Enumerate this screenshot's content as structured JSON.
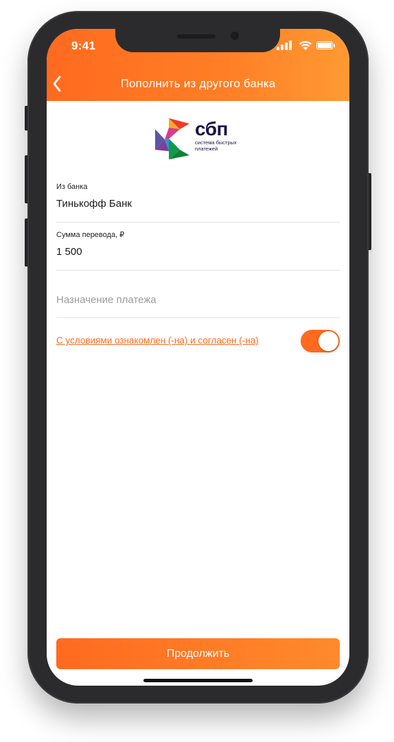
{
  "status_bar": {
    "time": "9:41"
  },
  "nav": {
    "title": "Пополнить из другого банка"
  },
  "logo": {
    "word": "сбп",
    "subtitle": "система быстрых платежей"
  },
  "form": {
    "bank": {
      "label": "Из банка",
      "value": "Тинькофф Банк"
    },
    "amount": {
      "label": "Сумма перевода, ₽",
      "value": "1 500"
    },
    "purpose": {
      "placeholder": "Назначение платежа"
    }
  },
  "agreement": {
    "text": "С условиями ознакомлен (-на) и согласен (-на)",
    "checked": true
  },
  "actions": {
    "continue_label": "Продолжить"
  },
  "colors": {
    "accent": "#ff6a1f",
    "accent_light": "#ff9a33",
    "logo_text": "#1d1346"
  }
}
